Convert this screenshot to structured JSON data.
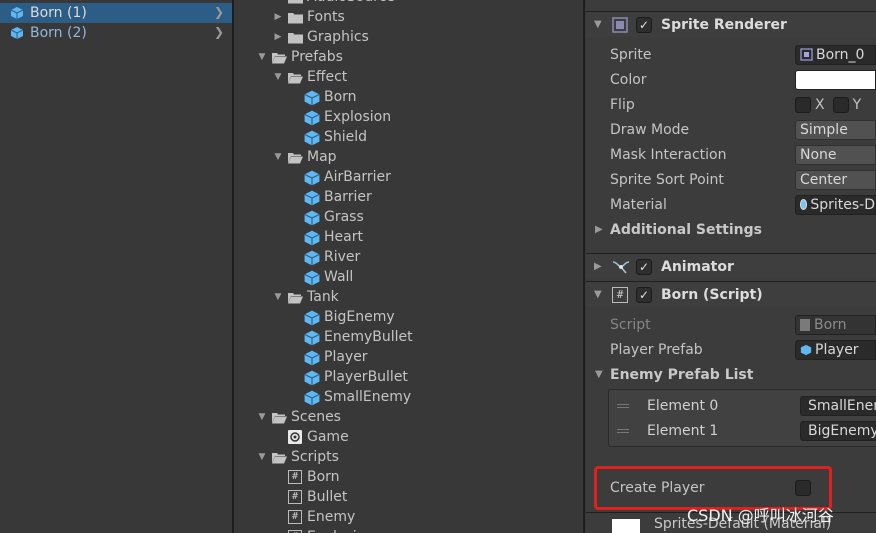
{
  "hierarchy": {
    "items": [
      {
        "label": "Born (1)",
        "selected": true
      },
      {
        "label": "Born (2)",
        "selected": false
      }
    ]
  },
  "project": {
    "items": [
      {
        "label": "AudioSource",
        "type": "folder-closed",
        "expanded": false
      },
      {
        "label": "Fonts",
        "type": "folder-closed",
        "expanded": false
      },
      {
        "label": "Graphics",
        "type": "folder-closed",
        "expanded": false
      },
      {
        "label": "Prefabs",
        "type": "folder-open",
        "expanded": true
      },
      {
        "label": "Effect",
        "type": "folder-open",
        "expanded": true
      },
      {
        "label": "Born",
        "type": "prefab"
      },
      {
        "label": "Explosion",
        "type": "prefab"
      },
      {
        "label": "Shield",
        "type": "prefab"
      },
      {
        "label": "Map",
        "type": "folder-open",
        "expanded": true
      },
      {
        "label": "AirBarrier",
        "type": "prefab"
      },
      {
        "label": "Barrier",
        "type": "prefab"
      },
      {
        "label": "Grass",
        "type": "prefab"
      },
      {
        "label": "Heart",
        "type": "prefab"
      },
      {
        "label": "River",
        "type": "prefab"
      },
      {
        "label": "Wall",
        "type": "prefab"
      },
      {
        "label": "Tank",
        "type": "folder-open",
        "expanded": true
      },
      {
        "label": "BigEnemy",
        "type": "prefab"
      },
      {
        "label": "EnemyBullet",
        "type": "prefab"
      },
      {
        "label": "Player",
        "type": "prefab"
      },
      {
        "label": "PlayerBullet",
        "type": "prefab"
      },
      {
        "label": "SmallEnemy",
        "type": "prefab"
      },
      {
        "label": "Scenes",
        "type": "folder-open",
        "expanded": true
      },
      {
        "label": "Game",
        "type": "scene"
      },
      {
        "label": "Scripts",
        "type": "folder-open",
        "expanded": true
      },
      {
        "label": "Born",
        "type": "script"
      },
      {
        "label": "Bullet",
        "type": "script"
      },
      {
        "label": "Enemy",
        "type": "script"
      },
      {
        "label": "Explosion",
        "type": "script"
      }
    ]
  },
  "inspector": {
    "sprite_renderer": {
      "title": "Sprite Renderer",
      "enabled": true,
      "fields": {
        "sprite_label": "Sprite",
        "sprite_value": "Born_0",
        "color_label": "Color",
        "flip_label": "Flip",
        "flip_x": "X",
        "flip_y": "Y",
        "draw_mode_label": "Draw Mode",
        "draw_mode_value": "Simple",
        "mask_label": "Mask Interaction",
        "mask_value": "None",
        "sort_point_label": "Sprite Sort Point",
        "sort_point_value": "Center",
        "material_label": "Material",
        "material_value": "Sprites-D"
      },
      "additional": "Additional Settings"
    },
    "animator": {
      "title": "Animator",
      "enabled": true
    },
    "born_script": {
      "title": "Born (Script)",
      "enabled": true,
      "script_label": "Script",
      "script_value": "Born",
      "player_prefab_label": "Player Prefab",
      "player_prefab_value": "Player",
      "enemy_list_label": "Enemy Prefab List",
      "elements": [
        {
          "label": "Element 0",
          "value": "SmallEnemy"
        },
        {
          "label": "Element 1",
          "value": "BigEnemy"
        }
      ],
      "create_player_label": "Create Player",
      "create_player_checked": false
    },
    "material_footer": "Sprites-Default (Material)"
  },
  "watermark": "CSDN @呼叫冰河谷",
  "colors": {
    "selection": "#2c5d87",
    "prefab_blue": "#5fb7f2",
    "highlight_red": "#e0201e"
  }
}
